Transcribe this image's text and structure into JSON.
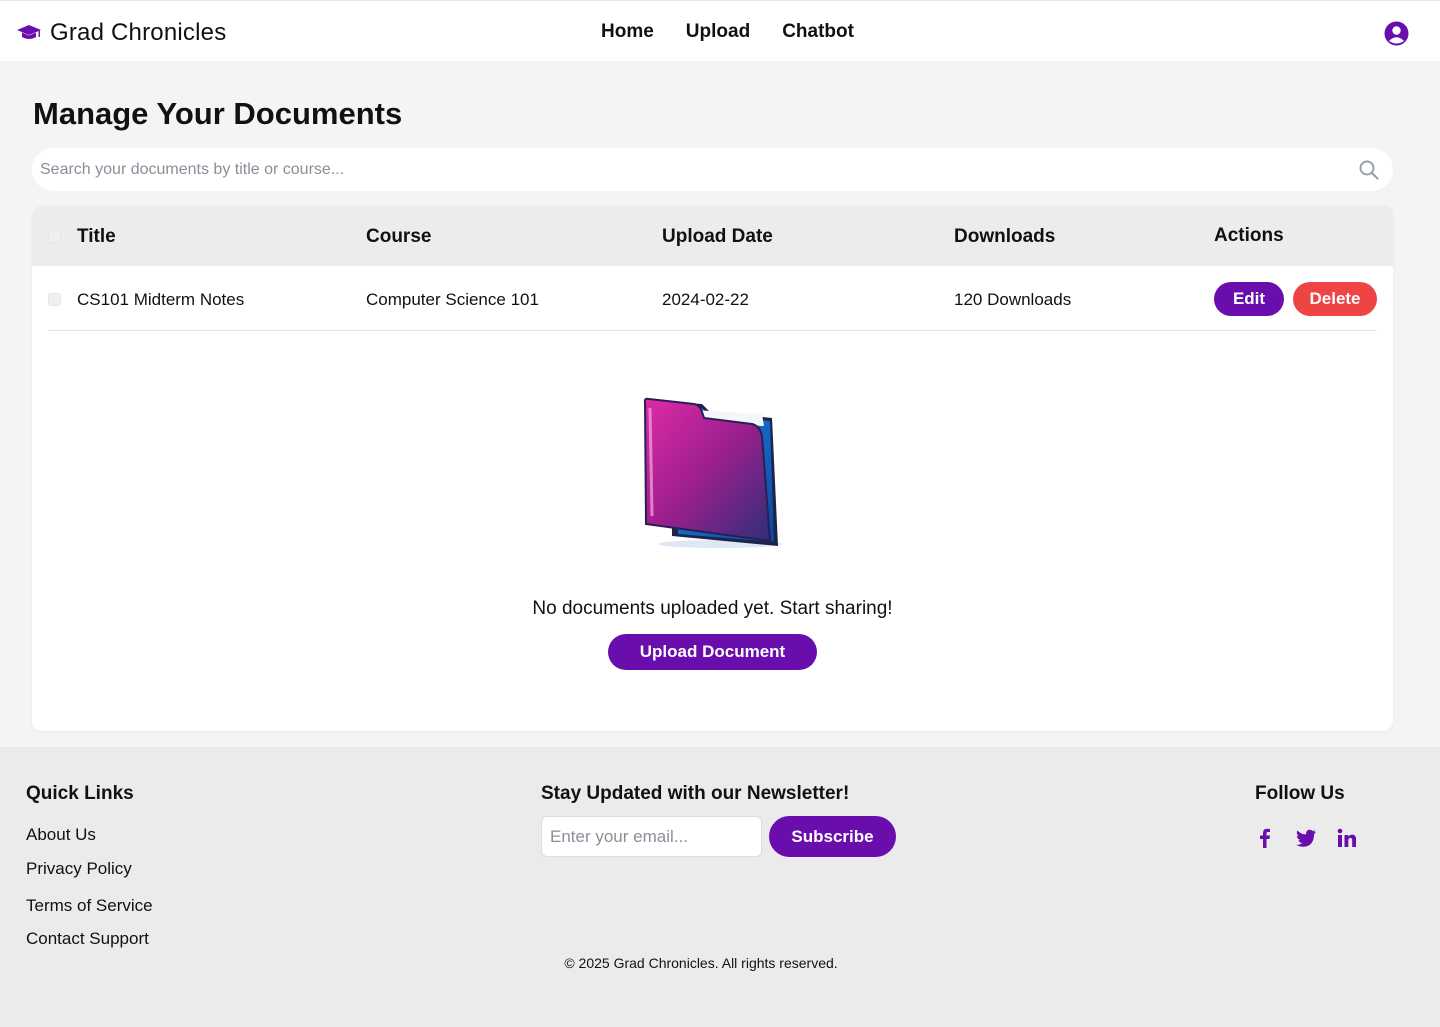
{
  "brand": {
    "name": "Grad Chronicles",
    "icon": "graduation-cap-icon"
  },
  "nav": {
    "links": [
      "Home",
      "Upload",
      "Chatbot"
    ],
    "user_icon": "user-circle-icon"
  },
  "main": {
    "title": "Manage Your Documents",
    "search_placeholder": "Search your documents by title or course..."
  },
  "table": {
    "headers": {
      "title": "Title",
      "course": "Course",
      "upload_date": "Upload Date",
      "downloads": "Downloads",
      "actions": "Actions"
    },
    "rows": [
      {
        "title": "CS101 Midterm Notes",
        "course": "Computer Science 101",
        "upload_date": "2024-02-22",
        "downloads": "120 Downloads",
        "edit_label": "Edit",
        "delete_label": "Delete"
      }
    ]
  },
  "empty_state": {
    "message": "No documents uploaded yet. Start sharing!",
    "button_label": "Upload Document",
    "icon": "folder-icon"
  },
  "footer": {
    "quick_links_heading": "Quick Links",
    "quick_links": [
      "About Us",
      "Privacy Policy",
      "Terms of Service",
      "Contact Support"
    ],
    "newsletter_heading": "Stay Updated with our Newsletter!",
    "email_placeholder": "Enter your email...",
    "subscribe_label": "Subscribe",
    "follow_heading": "Follow Us",
    "social_icons": [
      "facebook-icon",
      "twitter-icon",
      "linkedin-icon"
    ],
    "copyright": "© 2025 Grad Chronicles. All rights reserved."
  },
  "colors": {
    "accent": "#6a0dad",
    "danger": "#ef4444",
    "page_bg": "#f4f4f4",
    "footer_bg": "#ebebeb"
  }
}
